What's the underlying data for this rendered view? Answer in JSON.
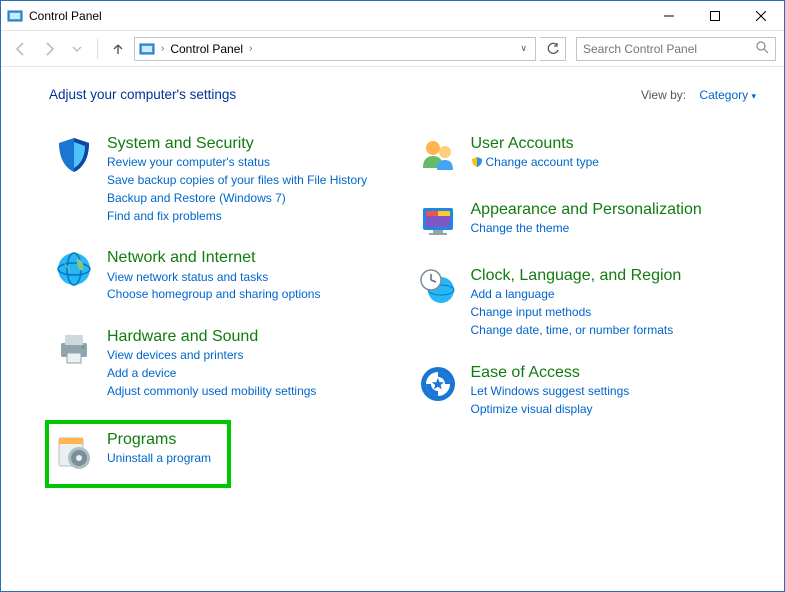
{
  "window": {
    "title": "Control Panel"
  },
  "nav": {
    "breadcrumb": "Control Panel",
    "search_placeholder": "Search Control Panel"
  },
  "header": {
    "adjust_heading": "Adjust your computer's settings",
    "view_by_label": "View by:",
    "view_by_value": "Category"
  },
  "left": [
    {
      "title": "System and Security",
      "links": [
        "Review your computer's status",
        "Save backup copies of your files with File History",
        "Backup and Restore (Windows 7)",
        "Find and fix problems"
      ]
    },
    {
      "title": "Network and Internet",
      "links": [
        "View network status and tasks",
        "Choose homegroup and sharing options"
      ]
    },
    {
      "title": "Hardware and Sound",
      "links": [
        "View devices and printers",
        "Add a device",
        "Adjust commonly used mobility settings"
      ]
    },
    {
      "title": "Programs",
      "links": [
        "Uninstall a program"
      ]
    }
  ],
  "right": [
    {
      "title": "User Accounts",
      "links": [
        "Change account type"
      ],
      "link_has_shield": true
    },
    {
      "title": "Appearance and Personalization",
      "links": [
        "Change the theme"
      ]
    },
    {
      "title": "Clock, Language, and Region",
      "links": [
        "Add a language",
        "Change input methods",
        "Change date, time, or number formats"
      ]
    },
    {
      "title": "Ease of Access",
      "links": [
        "Let Windows suggest settings",
        "Optimize visual display"
      ]
    }
  ]
}
